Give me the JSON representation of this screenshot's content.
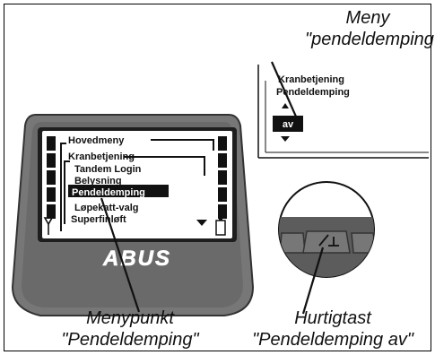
{
  "callouts": {
    "meny_line1": "Meny",
    "meny_line2": "\"pendeldemping\"",
    "menypunkt_line1": "Menypunkt",
    "menypunkt_line2": "\"Pendeldemping\"",
    "hurtigtast_line1": "Hurtigtast",
    "hurtigtast_line2": "\"Pendeldemping av\""
  },
  "display": {
    "title": "Hovedmeny",
    "submenu": "Kranbetjening",
    "items": [
      "Tandem Login",
      "Belysning",
      "Pendeldemping",
      "Løpekatt-valg",
      "Superfinløft"
    ],
    "selected_item": "Pendeldemping",
    "logo": "ABUS"
  },
  "zoom_panel": {
    "line1": "Kranbetjening",
    "line2": "Pendeldemping",
    "value": "av"
  },
  "colors": {
    "housing": "#6f6f6f",
    "housing_dark": "#3a3a3a",
    "screen": "#ffffff",
    "highlight": "#111111"
  },
  "icons": [
    "antenna-icon",
    "battery-icon",
    "scroll-up-arrow-icon",
    "scroll-down-arrow-icon",
    "softkey-icon"
  ]
}
